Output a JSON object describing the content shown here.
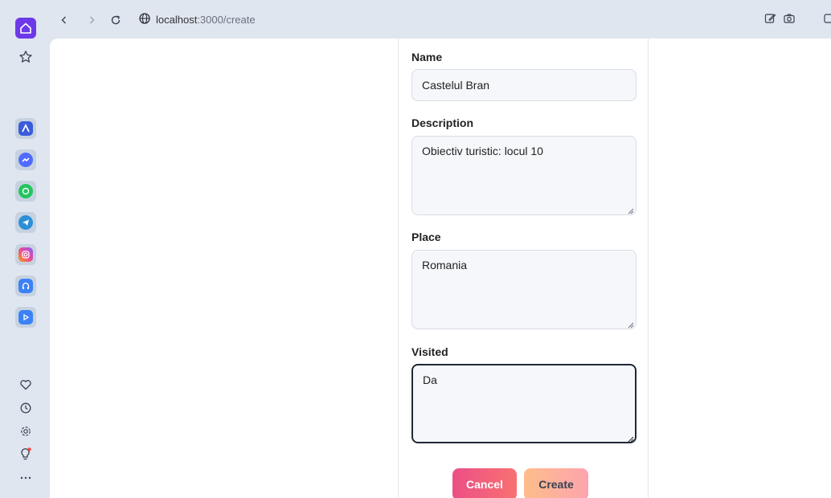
{
  "browser": {
    "url_host": "localhost",
    "url_path": ":3000/create"
  },
  "sidebar": {
    "apps": [
      {
        "name": "app-icon-1",
        "color": "#3b5bdb"
      },
      {
        "name": "messenger-icon",
        "color": "#4f6bff"
      },
      {
        "name": "whatsapp-icon",
        "color": "#22c55e"
      },
      {
        "name": "telegram-icon",
        "color": "#2c8fd6"
      },
      {
        "name": "instagram-icon",
        "color": "#ec4899"
      },
      {
        "name": "headphones-icon",
        "color": "#3b82f6"
      },
      {
        "name": "player-icon",
        "color": "#3b82f6"
      }
    ]
  },
  "form": {
    "name_label": "Name",
    "name_value": "Castelul Bran",
    "description_label": "Description",
    "description_value": "Obiectiv turistic: locul 10",
    "place_label": "Place",
    "place_value": "Romania",
    "visited_label": "Visited",
    "visited_value": "Da",
    "cancel_label": "Cancel",
    "create_label": "Create"
  },
  "colors": {
    "accent": "#6d39e8",
    "cancel_gradient_start": "#ec4f86",
    "create_gradient_start": "#fdbd8a"
  }
}
